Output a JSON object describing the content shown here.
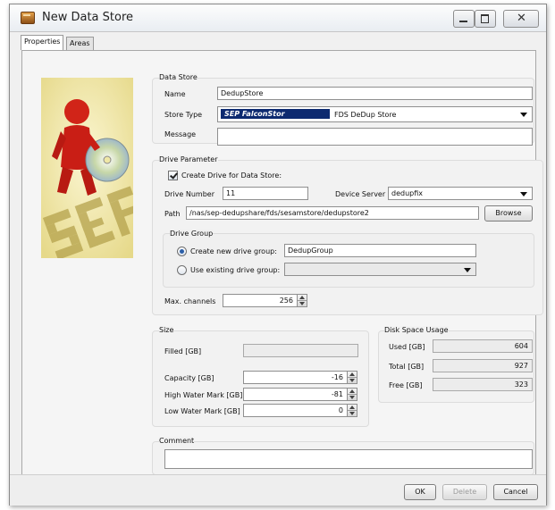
{
  "window": {
    "title": "New Data Store"
  },
  "tabs": [
    {
      "label": "Properties",
      "active": true
    },
    {
      "label": "Areas",
      "active": false
    }
  ],
  "data_store": {
    "group_label": "Data Store",
    "name_label": "Name",
    "name_value": "DedupStore",
    "store_type_label": "Store Type",
    "store_type_logo": "SEP FalconStor",
    "store_type_value": "FDS DeDup Store",
    "message_label": "Message",
    "message_value": ""
  },
  "drive_parameter": {
    "group_label": "Drive Parameter",
    "create_drive_label": "Create Drive for Data Store:",
    "create_drive_checked": true,
    "drive_number_label": "Drive Number",
    "drive_number_value": "11",
    "device_server_label": "Device Server",
    "device_server_value": "dedupfix",
    "path_label": "Path",
    "path_value": "/nas/sep-dedupshare/fds/sesamstore/dedupstore2",
    "browse_label": "Browse",
    "drive_group": {
      "group_label": "Drive Group",
      "create_new_label": "Create new drive group:",
      "create_new_value": "DedupGroup",
      "create_new_selected": true,
      "use_existing_label": "Use existing drive group:",
      "use_existing_value": ""
    },
    "max_channels_label": "Max. channels",
    "max_channels_value": "256"
  },
  "size": {
    "group_label": "Size",
    "filled_label": "Filled [GB]",
    "filled_value": "",
    "capacity_label": "Capacity [GB]",
    "capacity_value": "-16",
    "high_water_label": "High Water Mark [GB]",
    "high_water_value": "-81",
    "low_water_label": "Low Water Mark [GB]",
    "low_water_value": "0"
  },
  "disk_space": {
    "group_label": "Disk Space Usage",
    "used_label": "Used [GB]",
    "used_value": "604",
    "total_label": "Total [GB]",
    "total_value": "927",
    "free_label": "Free [GB]",
    "free_value": "323"
  },
  "comment": {
    "group_label": "Comment",
    "value": ""
  },
  "buttons": {
    "ok": "OK",
    "delete": "Delete",
    "cancel": "Cancel"
  },
  "colors": {
    "accent": "#2c5fa8",
    "logo_banner": "#0d2a70",
    "figure_red": "#cc1f17"
  }
}
